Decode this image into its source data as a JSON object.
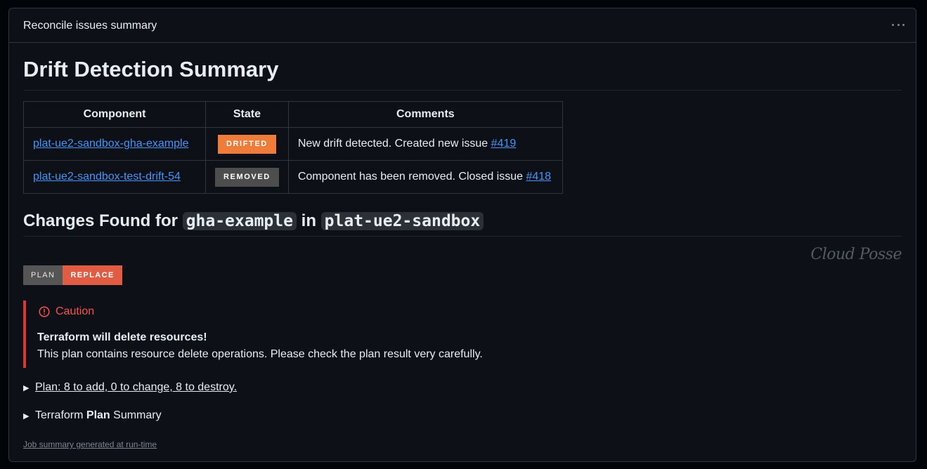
{
  "panel": {
    "title": "Reconcile issues summary"
  },
  "heading": "Drift Detection Summary",
  "table": {
    "headers": [
      "Component",
      "State",
      "Comments"
    ],
    "rows": [
      {
        "component": "plat-ue2-sandbox-gha-example",
        "state": "DRIFTED",
        "state_color": "#f07c3a",
        "comment": "New drift detected. Created new issue ",
        "issue": "#419"
      },
      {
        "component": "plat-ue2-sandbox-test-drift-54",
        "state": "REMOVED",
        "state_color": "#4d4d4d",
        "comment": "Component has been removed. Closed issue ",
        "issue": "#418"
      }
    ]
  },
  "changes": {
    "prefix": "Changes Found for ",
    "component": "gha-example",
    "middle": " in ",
    "stack": "plat-ue2-sandbox"
  },
  "logo_text": "Cloud Posse",
  "plan_badge": {
    "left": "PLAN",
    "right": "REPLACE"
  },
  "caution": {
    "title": "Caution",
    "strong": "Terraform will delete resources!",
    "text": "This plan contains resource delete operations. Please check the plan result very carefully."
  },
  "details": {
    "plan": "Plan: 8 to add, 0 to change, 8 to destroy.",
    "summary_prefix": "Terraform ",
    "summary_bold": "Plan",
    "summary_suffix": " Summary"
  },
  "footer": "Job summary generated at run-time",
  "colors": {
    "accent_link": "#4493f8",
    "caution": "#f85149",
    "caution_border": "#da3633"
  },
  "icons": {
    "menu": "kebab-horizontal-icon",
    "caution": "stop-icon",
    "expand": "triangle-right-icon"
  }
}
